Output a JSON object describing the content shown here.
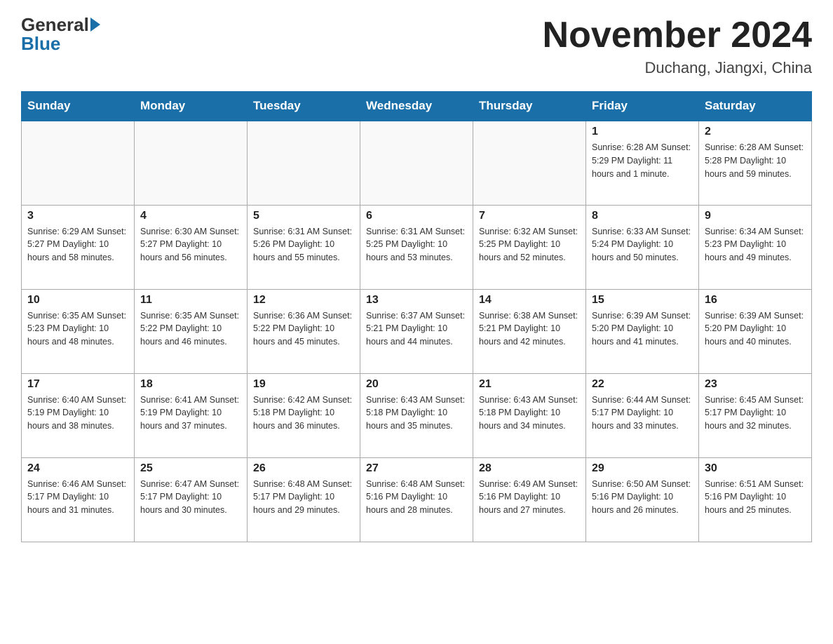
{
  "header": {
    "logo_general": "General",
    "logo_blue": "Blue",
    "month_title": "November 2024",
    "location": "Duchang, Jiangxi, China"
  },
  "weekdays": [
    "Sunday",
    "Monday",
    "Tuesday",
    "Wednesday",
    "Thursday",
    "Friday",
    "Saturday"
  ],
  "weeks": [
    [
      {
        "day": "",
        "info": ""
      },
      {
        "day": "",
        "info": ""
      },
      {
        "day": "",
        "info": ""
      },
      {
        "day": "",
        "info": ""
      },
      {
        "day": "",
        "info": ""
      },
      {
        "day": "1",
        "info": "Sunrise: 6:28 AM\nSunset: 5:29 PM\nDaylight: 11 hours and 1 minute."
      },
      {
        "day": "2",
        "info": "Sunrise: 6:28 AM\nSunset: 5:28 PM\nDaylight: 10 hours and 59 minutes."
      }
    ],
    [
      {
        "day": "3",
        "info": "Sunrise: 6:29 AM\nSunset: 5:27 PM\nDaylight: 10 hours and 58 minutes."
      },
      {
        "day": "4",
        "info": "Sunrise: 6:30 AM\nSunset: 5:27 PM\nDaylight: 10 hours and 56 minutes."
      },
      {
        "day": "5",
        "info": "Sunrise: 6:31 AM\nSunset: 5:26 PM\nDaylight: 10 hours and 55 minutes."
      },
      {
        "day": "6",
        "info": "Sunrise: 6:31 AM\nSunset: 5:25 PM\nDaylight: 10 hours and 53 minutes."
      },
      {
        "day": "7",
        "info": "Sunrise: 6:32 AM\nSunset: 5:25 PM\nDaylight: 10 hours and 52 minutes."
      },
      {
        "day": "8",
        "info": "Sunrise: 6:33 AM\nSunset: 5:24 PM\nDaylight: 10 hours and 50 minutes."
      },
      {
        "day": "9",
        "info": "Sunrise: 6:34 AM\nSunset: 5:23 PM\nDaylight: 10 hours and 49 minutes."
      }
    ],
    [
      {
        "day": "10",
        "info": "Sunrise: 6:35 AM\nSunset: 5:23 PM\nDaylight: 10 hours and 48 minutes."
      },
      {
        "day": "11",
        "info": "Sunrise: 6:35 AM\nSunset: 5:22 PM\nDaylight: 10 hours and 46 minutes."
      },
      {
        "day": "12",
        "info": "Sunrise: 6:36 AM\nSunset: 5:22 PM\nDaylight: 10 hours and 45 minutes."
      },
      {
        "day": "13",
        "info": "Sunrise: 6:37 AM\nSunset: 5:21 PM\nDaylight: 10 hours and 44 minutes."
      },
      {
        "day": "14",
        "info": "Sunrise: 6:38 AM\nSunset: 5:21 PM\nDaylight: 10 hours and 42 minutes."
      },
      {
        "day": "15",
        "info": "Sunrise: 6:39 AM\nSunset: 5:20 PM\nDaylight: 10 hours and 41 minutes."
      },
      {
        "day": "16",
        "info": "Sunrise: 6:39 AM\nSunset: 5:20 PM\nDaylight: 10 hours and 40 minutes."
      }
    ],
    [
      {
        "day": "17",
        "info": "Sunrise: 6:40 AM\nSunset: 5:19 PM\nDaylight: 10 hours and 38 minutes."
      },
      {
        "day": "18",
        "info": "Sunrise: 6:41 AM\nSunset: 5:19 PM\nDaylight: 10 hours and 37 minutes."
      },
      {
        "day": "19",
        "info": "Sunrise: 6:42 AM\nSunset: 5:18 PM\nDaylight: 10 hours and 36 minutes."
      },
      {
        "day": "20",
        "info": "Sunrise: 6:43 AM\nSunset: 5:18 PM\nDaylight: 10 hours and 35 minutes."
      },
      {
        "day": "21",
        "info": "Sunrise: 6:43 AM\nSunset: 5:18 PM\nDaylight: 10 hours and 34 minutes."
      },
      {
        "day": "22",
        "info": "Sunrise: 6:44 AM\nSunset: 5:17 PM\nDaylight: 10 hours and 33 minutes."
      },
      {
        "day": "23",
        "info": "Sunrise: 6:45 AM\nSunset: 5:17 PM\nDaylight: 10 hours and 32 minutes."
      }
    ],
    [
      {
        "day": "24",
        "info": "Sunrise: 6:46 AM\nSunset: 5:17 PM\nDaylight: 10 hours and 31 minutes."
      },
      {
        "day": "25",
        "info": "Sunrise: 6:47 AM\nSunset: 5:17 PM\nDaylight: 10 hours and 30 minutes."
      },
      {
        "day": "26",
        "info": "Sunrise: 6:48 AM\nSunset: 5:17 PM\nDaylight: 10 hours and 29 minutes."
      },
      {
        "day": "27",
        "info": "Sunrise: 6:48 AM\nSunset: 5:16 PM\nDaylight: 10 hours and 28 minutes."
      },
      {
        "day": "28",
        "info": "Sunrise: 6:49 AM\nSunset: 5:16 PM\nDaylight: 10 hours and 27 minutes."
      },
      {
        "day": "29",
        "info": "Sunrise: 6:50 AM\nSunset: 5:16 PM\nDaylight: 10 hours and 26 minutes."
      },
      {
        "day": "30",
        "info": "Sunrise: 6:51 AM\nSunset: 5:16 PM\nDaylight: 10 hours and 25 minutes."
      }
    ]
  ]
}
